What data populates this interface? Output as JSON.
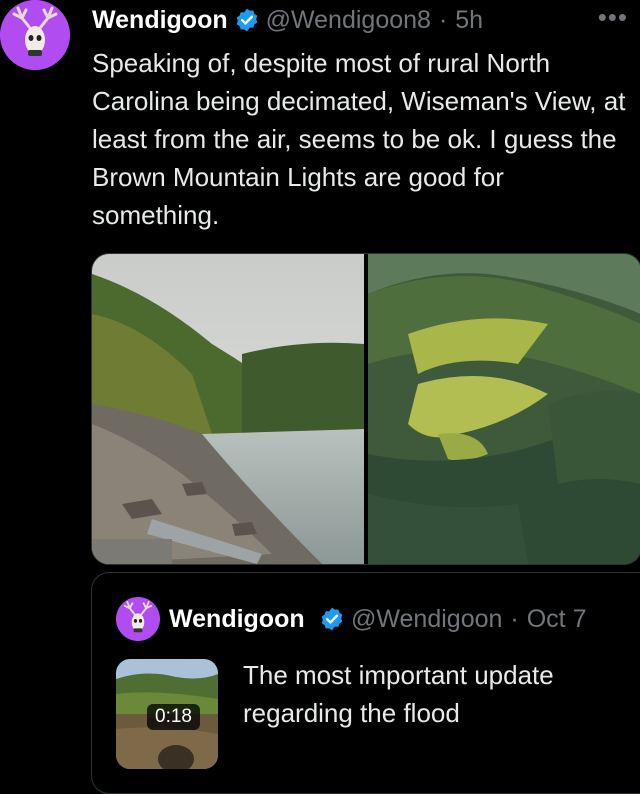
{
  "tweet": {
    "author_name": "Wendigoon",
    "handle": "@Wendigoon8",
    "separator": "·",
    "time": "5h",
    "more_label": "•••",
    "text": "Speaking of, despite most of rural North Carolina being decimated, Wiseman's View, at least from the air, seems to be ok. I guess the Brown Mountain Lights are good for something."
  },
  "quoted_tweet": {
    "author_name": "Wendigoon",
    "handle": "@Wendigoon",
    "separator": "·",
    "date": "Oct 7",
    "video_duration": "0:18",
    "text": "The most important update regarding the flood"
  },
  "colors": {
    "background": "#000000",
    "avatar": "#b14cf0",
    "verified": "#1d9bf0",
    "secondary_text": "#71767b"
  },
  "icons": [
    "verified-badge-icon",
    "more-options-icon",
    "deer-skull-avatar-icon"
  ]
}
